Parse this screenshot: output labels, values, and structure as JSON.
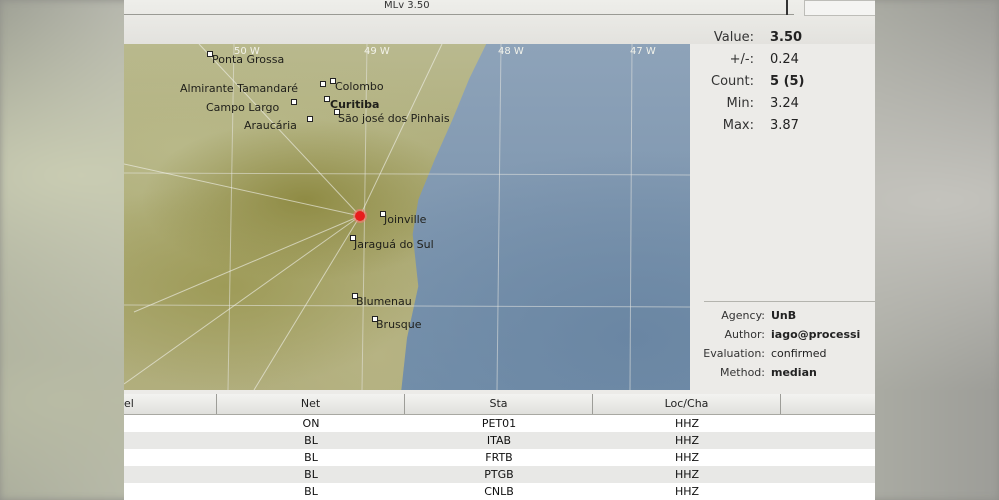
{
  "window": {
    "magnitude_label": "MLv 3.50"
  },
  "map": {
    "longitudes": [
      "50 W",
      "49 W",
      "48 W",
      "47 W"
    ],
    "cities": [
      {
        "name": "Ponta Grossa",
        "bold": false
      },
      {
        "name": "Almirante Tamandaré",
        "bold": false
      },
      {
        "name": "Colombo",
        "bold": false
      },
      {
        "name": "Campo Largo",
        "bold": false
      },
      {
        "name": "Curitiba",
        "bold": true
      },
      {
        "name": "Araucária",
        "bold": false
      },
      {
        "name": "São josé dos Pinhais",
        "bold": false
      },
      {
        "name": "Joinville",
        "bold": false
      },
      {
        "name": "Jaraguá do Sul",
        "bold": false
      },
      {
        "name": "Blumenau",
        "bold": false
      },
      {
        "name": "Brusque",
        "bold": false
      }
    ]
  },
  "magnitude": {
    "value_label": "Value:",
    "value": "3.50",
    "uncertainty_label": "+/-:",
    "uncertainty": "0.24",
    "count_label": "Count:",
    "count": "5 (5)",
    "min_label": "Min:",
    "min": "3.24",
    "max_label": "Max:",
    "max": "3.87"
  },
  "origin": {
    "agency_label": "Agency:",
    "agency": "UnB",
    "author_label": "Author:",
    "author": "iago@processi",
    "evaluation_label": "Evaluation:",
    "evaluation": "confirmed",
    "method_label": "Method:",
    "method": "median"
  },
  "table": {
    "columns": [
      "el",
      "Net",
      "Sta",
      "Loc/Cha",
      ""
    ],
    "rows": [
      {
        "net": "ON",
        "sta": "PET01",
        "cha": "HHZ"
      },
      {
        "net": "BL",
        "sta": "ITAB",
        "cha": "HHZ"
      },
      {
        "net": "BL",
        "sta": "FRTB",
        "cha": "HHZ"
      },
      {
        "net": "BL",
        "sta": "PTGB",
        "cha": "HHZ"
      },
      {
        "net": "BL",
        "sta": "CNLB",
        "cha": "HHZ"
      }
    ]
  }
}
